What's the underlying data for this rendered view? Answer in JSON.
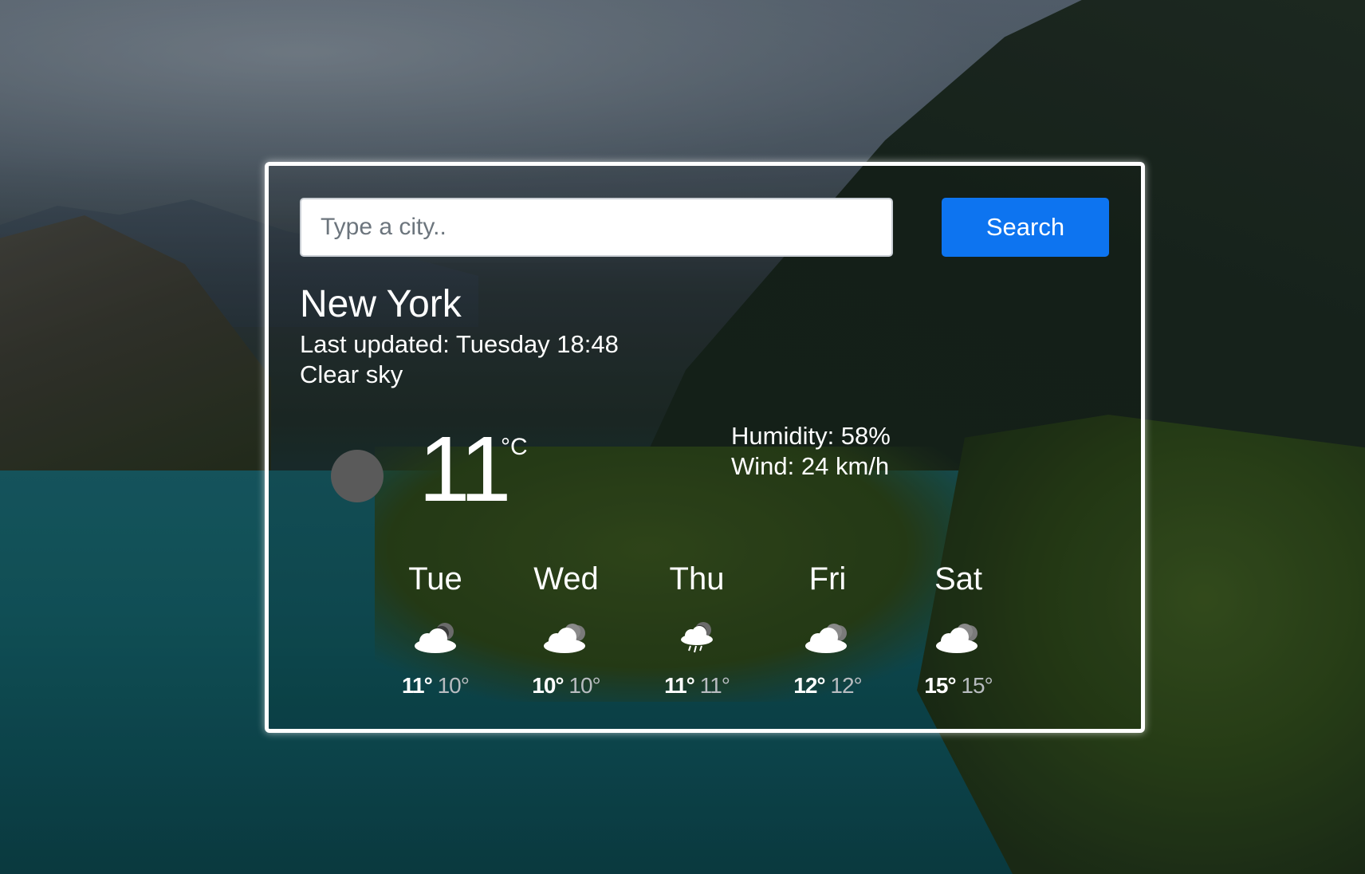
{
  "search": {
    "placeholder": "Type a city..",
    "button_label": "Search"
  },
  "current": {
    "city": "New York",
    "last_updated": "Last updated: Tuesday 18:48",
    "condition": "Clear sky",
    "icon": "moon-icon",
    "temperature": "11",
    "unit": "°C",
    "humidity": "Humidity: 58%",
    "wind": "Wind: 24 km/h"
  },
  "forecast": [
    {
      "day": "Tue",
      "icon": "cloudy-night-icon",
      "max": "11°",
      "min": "10°"
    },
    {
      "day": "Wed",
      "icon": "cloudy-night-icon",
      "max": "10°",
      "min": "10°"
    },
    {
      "day": "Thu",
      "icon": "rain-night-icon",
      "max": "11°",
      "min": "11°"
    },
    {
      "day": "Fri",
      "icon": "cloudy-night-icon",
      "max": "12°",
      "min": "12°"
    },
    {
      "day": "Sat",
      "icon": "cloudy-night-icon",
      "max": "15°",
      "min": "15°"
    }
  ],
  "colors": {
    "button": "#0d74f0",
    "card_border": "#ffffff",
    "min_temp": "#b8bcc0"
  }
}
